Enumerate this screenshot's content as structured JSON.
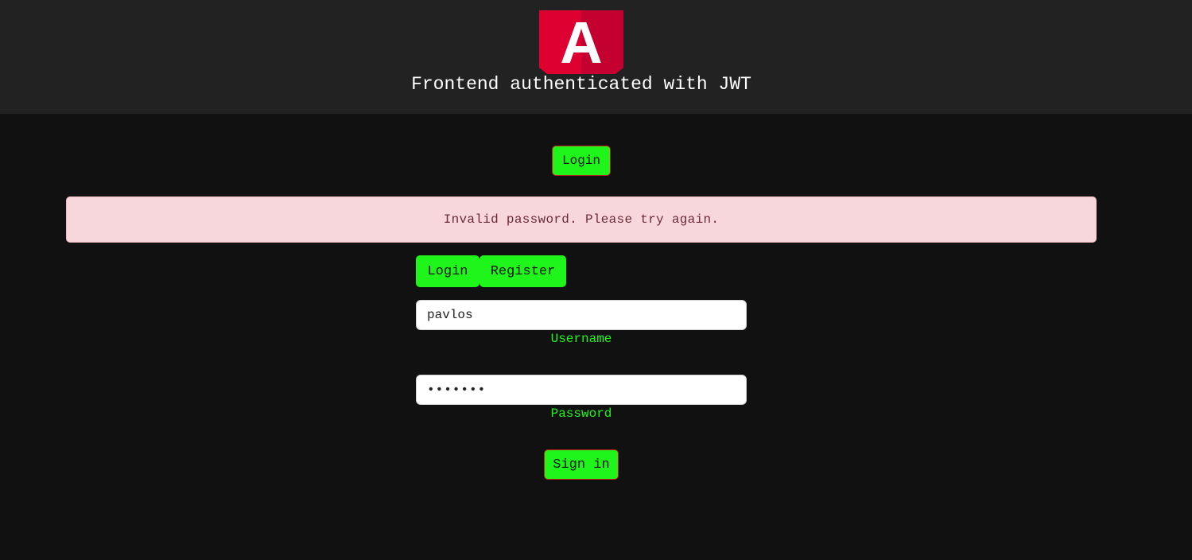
{
  "header": {
    "logo_letter": "A",
    "title": "Frontend authenticated with JWT"
  },
  "nav": {
    "login_label": "Login"
  },
  "alert": {
    "message": "Invalid password. Please try again."
  },
  "tabs": [
    {
      "label": "Login"
    },
    {
      "label": "Register"
    }
  ],
  "form": {
    "username_value": "pavlos",
    "username_label": "Username",
    "password_value": "•••••••",
    "password_label": "Password",
    "submit_label": "Sign in"
  },
  "colors": {
    "accent": "#1ff51a",
    "logo_red": "#dd0031",
    "alert_bg": "#f7d7dc"
  }
}
